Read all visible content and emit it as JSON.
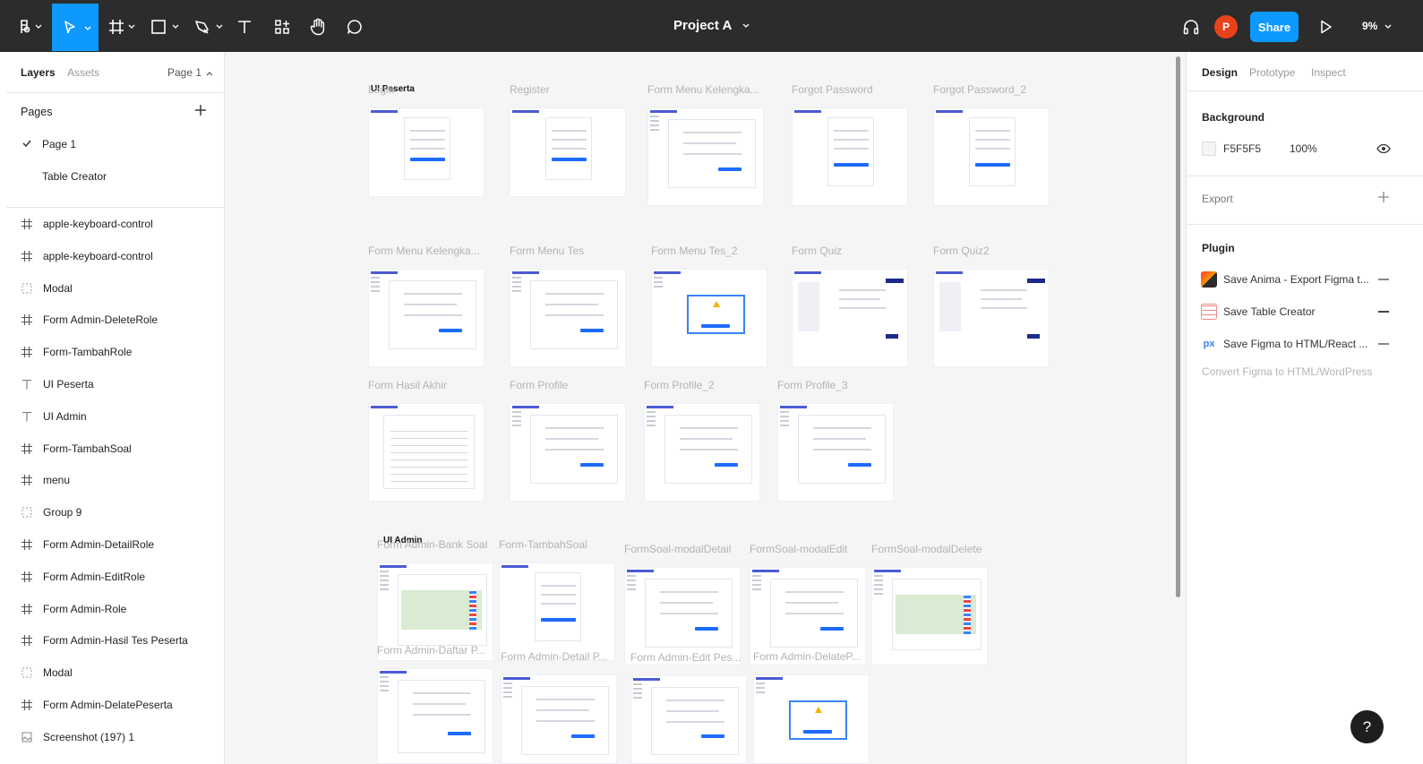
{
  "toolbar": {
    "title": "Project A",
    "avatar_initial": "P",
    "share_label": "Share",
    "zoom": "9%",
    "accent": "#0d99ff",
    "tools": [
      "main-menu-icon",
      "move-icon",
      "frame-icon",
      "rectangle-icon",
      "pen-icon",
      "text-icon",
      "resources-icon",
      "hand-icon",
      "comment-icon"
    ]
  },
  "left_panel": {
    "tabs": [
      "Layers",
      "Assets"
    ],
    "page_selector": "Page 1",
    "pages_title": "Pages",
    "pages": [
      {
        "label": "Page 1",
        "selected": true
      },
      {
        "label": "Table Creator",
        "selected": false
      }
    ],
    "layers": [
      {
        "icon": "frame-icon",
        "label": "apple-keyboard-control"
      },
      {
        "icon": "frame-icon",
        "label": "apple-keyboard-control"
      },
      {
        "icon": "component-dashed-icon",
        "label": "Modal"
      },
      {
        "icon": "frame-icon",
        "label": "Form Admin-DeleteRole"
      },
      {
        "icon": "frame-icon",
        "label": "Form-TambahRole"
      },
      {
        "icon": "text-icon",
        "label": "UI Peserta"
      },
      {
        "icon": "text-icon",
        "label": "UI Admin"
      },
      {
        "icon": "frame-icon",
        "label": "Form-TambahSoal"
      },
      {
        "icon": "frame-icon",
        "label": "menu"
      },
      {
        "icon": "group-icon",
        "label": "Group 9"
      },
      {
        "icon": "frame-icon",
        "label": "Form Admin-DetailRole"
      },
      {
        "icon": "frame-icon",
        "label": "Form Admin-EditRole"
      },
      {
        "icon": "frame-icon",
        "label": "Form Admin-Role"
      },
      {
        "icon": "frame-icon",
        "label": "Form Admin-Hasil Tes Peserta"
      },
      {
        "icon": "component-dashed-icon",
        "label": "Modal"
      },
      {
        "icon": "frame-icon",
        "label": "Form Admin-DelatePeserta"
      },
      {
        "icon": "image-icon",
        "label": "Screenshot (197) 1"
      }
    ]
  },
  "canvas": {
    "sections": [
      "UI Peserta",
      "UI Admin"
    ],
    "frames": [
      "Login",
      "Register",
      "Form Menu Kelengka...",
      "Forgot Password",
      "Forgot Password_2",
      "Form Menu Kelengka...",
      "Form Menu Tes",
      "Form Menu Tes_2",
      "Form Quiz",
      "Form Quiz2",
      "Form Hasil Akhir",
      "Form Profile",
      "Form Profile_2",
      "Form Profile_3",
      "Form Admin-Bank Soal",
      "Form-TambahSoal",
      "FormSoal-modalDetail",
      "FormSoal-modalEdit",
      "FormSoal-modalDelete",
      "Form Admin-Daftar P...",
      "Form Admin-Detail P...",
      "Form Admin-Edit Pes...",
      "Form Admin-DelateP..."
    ]
  },
  "right_panel": {
    "tabs": [
      "Design",
      "Prototype",
      "Inspect"
    ],
    "background_title": "Background",
    "background_hex": "F5F5F5",
    "background_opacity": "100%",
    "export_title": "Export",
    "plugin_title": "Plugin",
    "plugins": [
      {
        "label": "Save Anima - Export Figma t...",
        "icon": "anima-icon"
      },
      {
        "label": "Save Table Creator",
        "icon": "table-creator-icon"
      },
      {
        "label": "Save Figma to HTML/React ...",
        "icon": "px-icon"
      }
    ],
    "plugin_hint": "Convert Figma to HTML/WordPress"
  },
  "help_label": "?"
}
